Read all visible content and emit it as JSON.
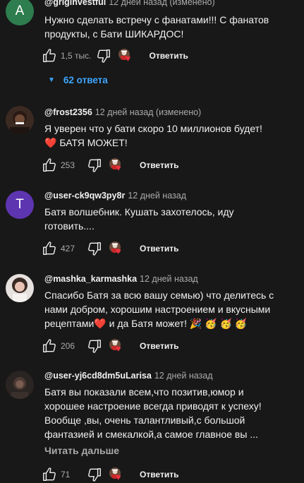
{
  "comments": [
    {
      "author": "@griginvestful",
      "time": "12 дней назад (изменено)",
      "avatar_letter": "A",
      "avatar_color": "#2e7d4f",
      "text": "Нужно сделать встречу с фанатами!!! С фанатов продукты, с Бати ШИКАРДОС!",
      "likes": "1,5 тыс.",
      "reply_label": "Ответить",
      "replies_label": "62 ответа"
    },
    {
      "author": "@frost2356",
      "time": "12 дней назад (изменено)",
      "text_line1": "Я уверен что у бати скоро 10 миллионов будет!",
      "heart": "❤️",
      "text_line2": "БАТЯ МОЖЕТ!",
      "likes": "253",
      "reply_label": "Ответить"
    },
    {
      "author": "@user-ck9qw3py8r",
      "time": "12 дней назад",
      "avatar_letter": "T",
      "avatar_color": "#5e35b1",
      "text": "Батя волшебник. Кушать захотелось, иду готовить....",
      "likes": "427",
      "reply_label": "Ответить"
    },
    {
      "author": "@mashka_karmashka",
      "time": "12 дней назад",
      "text_part1": "Спасибо Батя за всю вашу семью) что делитесь с нами добром, хорошим настроением и вкусными рецептами",
      "heart": "❤️",
      "text_part2": " и да Батя может! 🎉 🥳 🥳 🥳",
      "likes": "206",
      "reply_label": "Ответить"
    },
    {
      "author": "@user-yj6cd8dm5uLarisa",
      "time": "12 дней назад",
      "text": "Батя вы показали всем,что позитив,юмор и хорошее настроение всегда приводят к успеху! Вообще ,вы, очень талантливый,с большой фантазией и смекалкой,а самое главное вы ...",
      "read_more": "Читать дальше",
      "likes": "71",
      "reply_label": "Ответить"
    }
  ],
  "icons": {
    "like": "thumb-up-icon",
    "dislike": "thumb-down-icon",
    "creator_heart": "creator-heart-icon",
    "expand": "caret-down-icon"
  },
  "colors": {
    "background": "#181818",
    "link": "#3ea6ff",
    "heart": "#e8333e"
  }
}
